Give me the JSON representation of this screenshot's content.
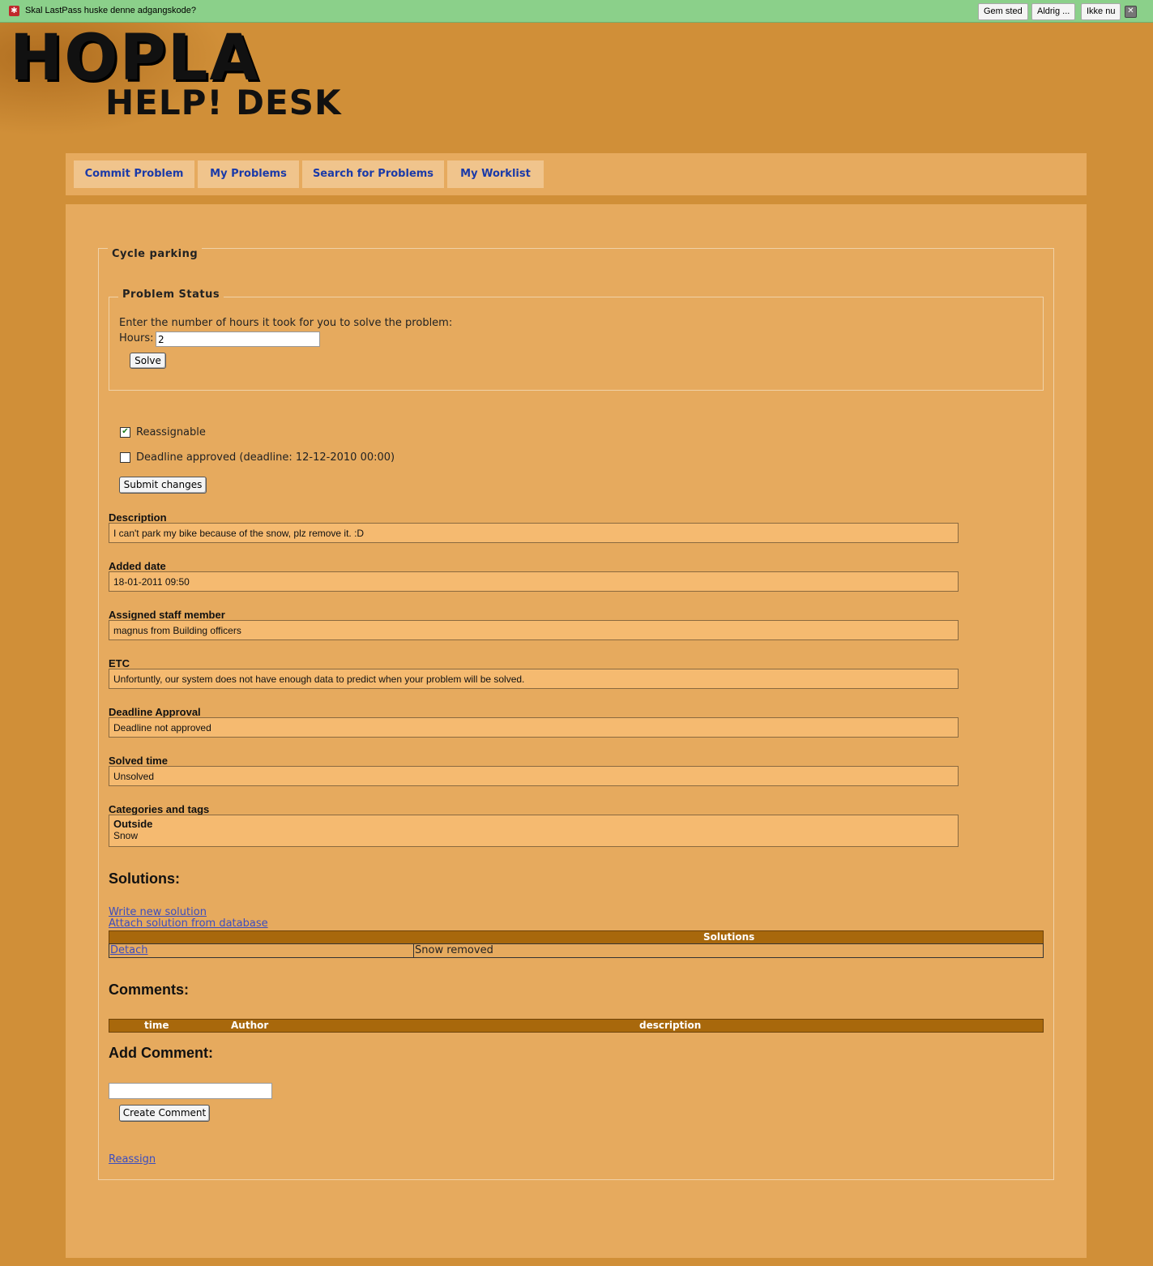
{
  "lastpass": {
    "prompt": "Skal LastPass huske denne adgangskode?",
    "save": "Gem sted",
    "never": "Aldrig ...",
    "not_now": "Ikke nu",
    "icon": "lastpass-star-icon",
    "close_icon": "close-icon"
  },
  "logo": {
    "line1": "HOPLA",
    "line2": "HELP! DESK"
  },
  "nav": {
    "items": [
      {
        "label": "Commit Problem"
      },
      {
        "label": "My Problems"
      },
      {
        "label": "Search for Problems"
      },
      {
        "label": "My Worklist"
      }
    ]
  },
  "problem": {
    "title": "Cycle parking",
    "status": {
      "legend": "Problem Status",
      "instruction": "Enter the number of hours it took for you to solve the problem:",
      "hours_label": "Hours:",
      "hours_value": "2",
      "solve_button": "Solve"
    },
    "reassignable": {
      "label": "Reassignable",
      "checked": true
    },
    "deadline_approved": {
      "label": "Deadline approved (deadline: 12-12-2010 00:00)",
      "checked": false
    },
    "submit_button": "Submit changes",
    "fields": {
      "description": {
        "label": "Description",
        "value": "I can't park my bike because of the snow, plz remove it. :D"
      },
      "added_date": {
        "label": "Added date",
        "value": "18-01-2011 09:50"
      },
      "assigned": {
        "label": "Assigned staff member",
        "value": "magnus from Building officers"
      },
      "etc": {
        "label": "ETC",
        "value": "Unfortuntly, our system does not have enough data to predict when your problem will be solved."
      },
      "deadline_approval": {
        "label": "Deadline Approval",
        "value": "Deadline not approved"
      },
      "solved_time": {
        "label": "Solved time",
        "value": "Unsolved"
      },
      "categories": {
        "label": "Categories and tags",
        "category": "Outside",
        "tag": "Snow"
      }
    },
    "solutions": {
      "heading": "Solutions:",
      "write_link": "Write new solution",
      "attach_link": "Attach solution from database",
      "table_header": "Solutions",
      "rows": [
        {
          "action": "Detach",
          "text": "Snow removed"
        }
      ]
    },
    "comments": {
      "heading": "Comments:",
      "columns": [
        "time",
        "Author",
        "description"
      ]
    },
    "add_comment": {
      "heading": "Add Comment:",
      "value": "",
      "button": "Create Comment"
    },
    "reassign_link": "Reassign"
  },
  "colors": {
    "page_bg": "#d08f38",
    "panel_bg": "#e6aa5e",
    "field_bg": "#f5ba70",
    "table_header_bg": "#a8680c",
    "nav_link": "#1b3aa8",
    "lastpass_bar": "#8bd08a"
  }
}
